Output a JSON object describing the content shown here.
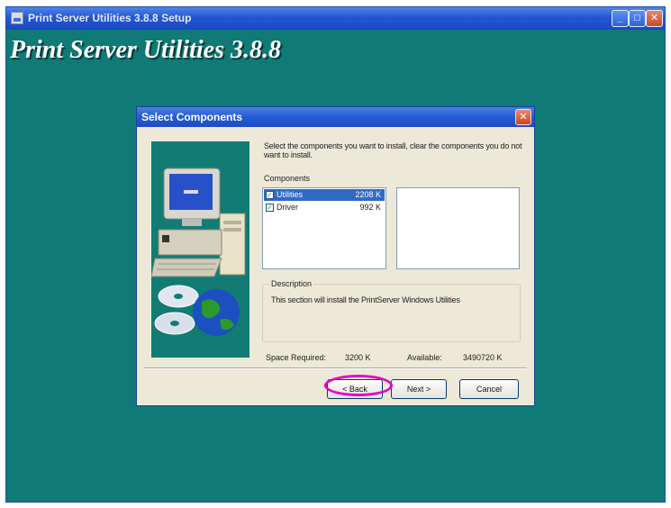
{
  "window": {
    "title": "Print Server Utilities 3.8.8 Setup",
    "heading": "Print Server Utilities 3.8.8",
    "controls": {
      "minimize": "_",
      "maximize": "□",
      "close": "✕"
    }
  },
  "dialog": {
    "title": "Select Components",
    "close": "✕",
    "intro": "Select the components you want to install, clear the components you do not want to install.",
    "components_label": "Components",
    "components": [
      {
        "name": "Utilities",
        "size": "2208 K",
        "checked": true,
        "selected": true
      },
      {
        "name": "Driver",
        "size": "992 K",
        "checked": true,
        "selected": false
      }
    ],
    "description_label": "Description",
    "description_text": "This section will install the PrintServer Windows Utilities",
    "space_required_label": "Space Required:",
    "space_required_value": "3200 K",
    "available_label": "Available:",
    "available_value": "3490720 K",
    "buttons": {
      "back": "< Back",
      "next": "Next >",
      "cancel": "Cancel"
    }
  },
  "colors": {
    "desktop": "#0f7a76",
    "titlebar": "#245ad4",
    "dialog_face": "#ece9d8",
    "selection": "#316ac5",
    "annotation": "#e600c8"
  },
  "icons": [
    "setup-icon",
    "computer-icon",
    "cd-globe-icon",
    "checkbox-icon",
    "close-icon"
  ]
}
